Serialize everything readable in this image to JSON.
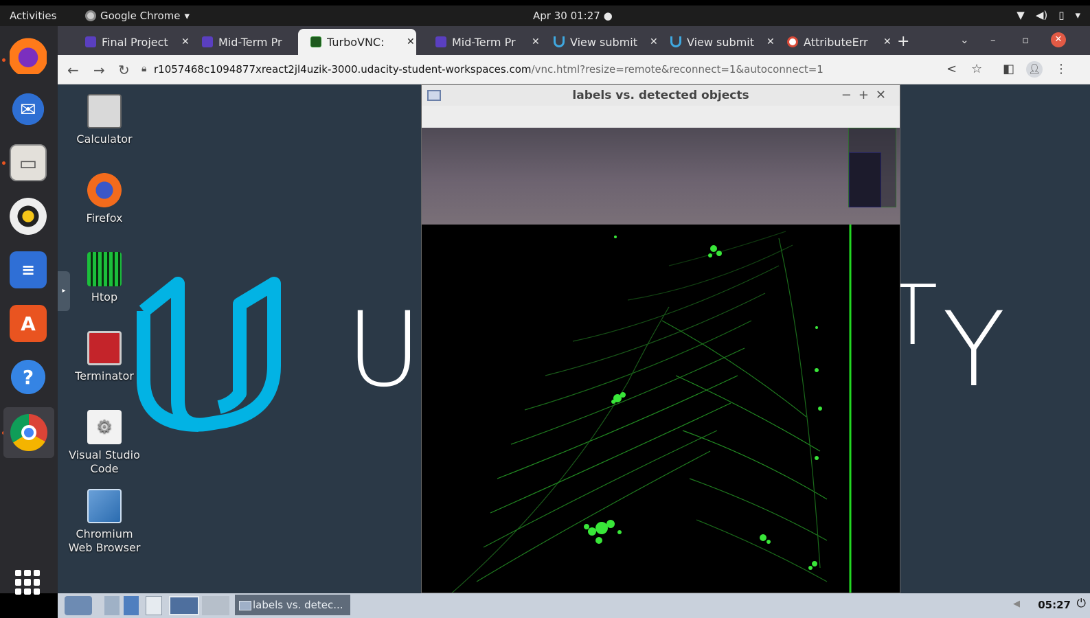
{
  "topbar": {
    "activities": "Activities",
    "app_name": "Google Chrome",
    "clock": "Apr 30  01:27",
    "tray": [
      "wifi-icon",
      "volume-icon",
      "battery-icon",
      "menu-arrow-icon"
    ]
  },
  "tabs": [
    {
      "label": "Final Project",
      "icon": "udacity-purple"
    },
    {
      "label": "Mid-Term Pr",
      "icon": "udacity-purple"
    },
    {
      "label": "TurboVNC: ",
      "icon": "vnc",
      "active": true
    },
    {
      "label": "Mid-Term Pr",
      "icon": "udacity-purple"
    },
    {
      "label": "View submit",
      "icon": "udacity-blue"
    },
    {
      "label": "View submit",
      "icon": "udacity-blue"
    },
    {
      "label": "AttributeErr",
      "icon": "google"
    }
  ],
  "addressbar": {
    "url_host": "r1057468c1094877xreact2jl4uzik-3000.udacity-student-workspaces.com",
    "url_path": "/vnc.html?resize=remote&reconnect=1&autoconnect=1"
  },
  "desktop": {
    "icons": [
      {
        "label": "Calculator"
      },
      {
        "label": "Firefox"
      },
      {
        "label": "Htop"
      },
      {
        "label": "Terminator"
      },
      {
        "label": "Visual Studio Code"
      },
      {
        "label": "Chromium Web Browser"
      }
    ],
    "wallpaper_text_left": "U",
    "wallpaper_text_right": "Y",
    "wallpaper_text_mid": "T"
  },
  "vnc_window": {
    "title": "labels vs. detected objects"
  },
  "taskbar": {
    "window_label": "labels vs. detec...",
    "clock": "05:27"
  },
  "colors": {
    "ubuntu_orange": "#e95420",
    "udacity_blue": "#02b3e4",
    "lidar_green": "#2bd62b",
    "desktop_bg": "#2b3947"
  }
}
